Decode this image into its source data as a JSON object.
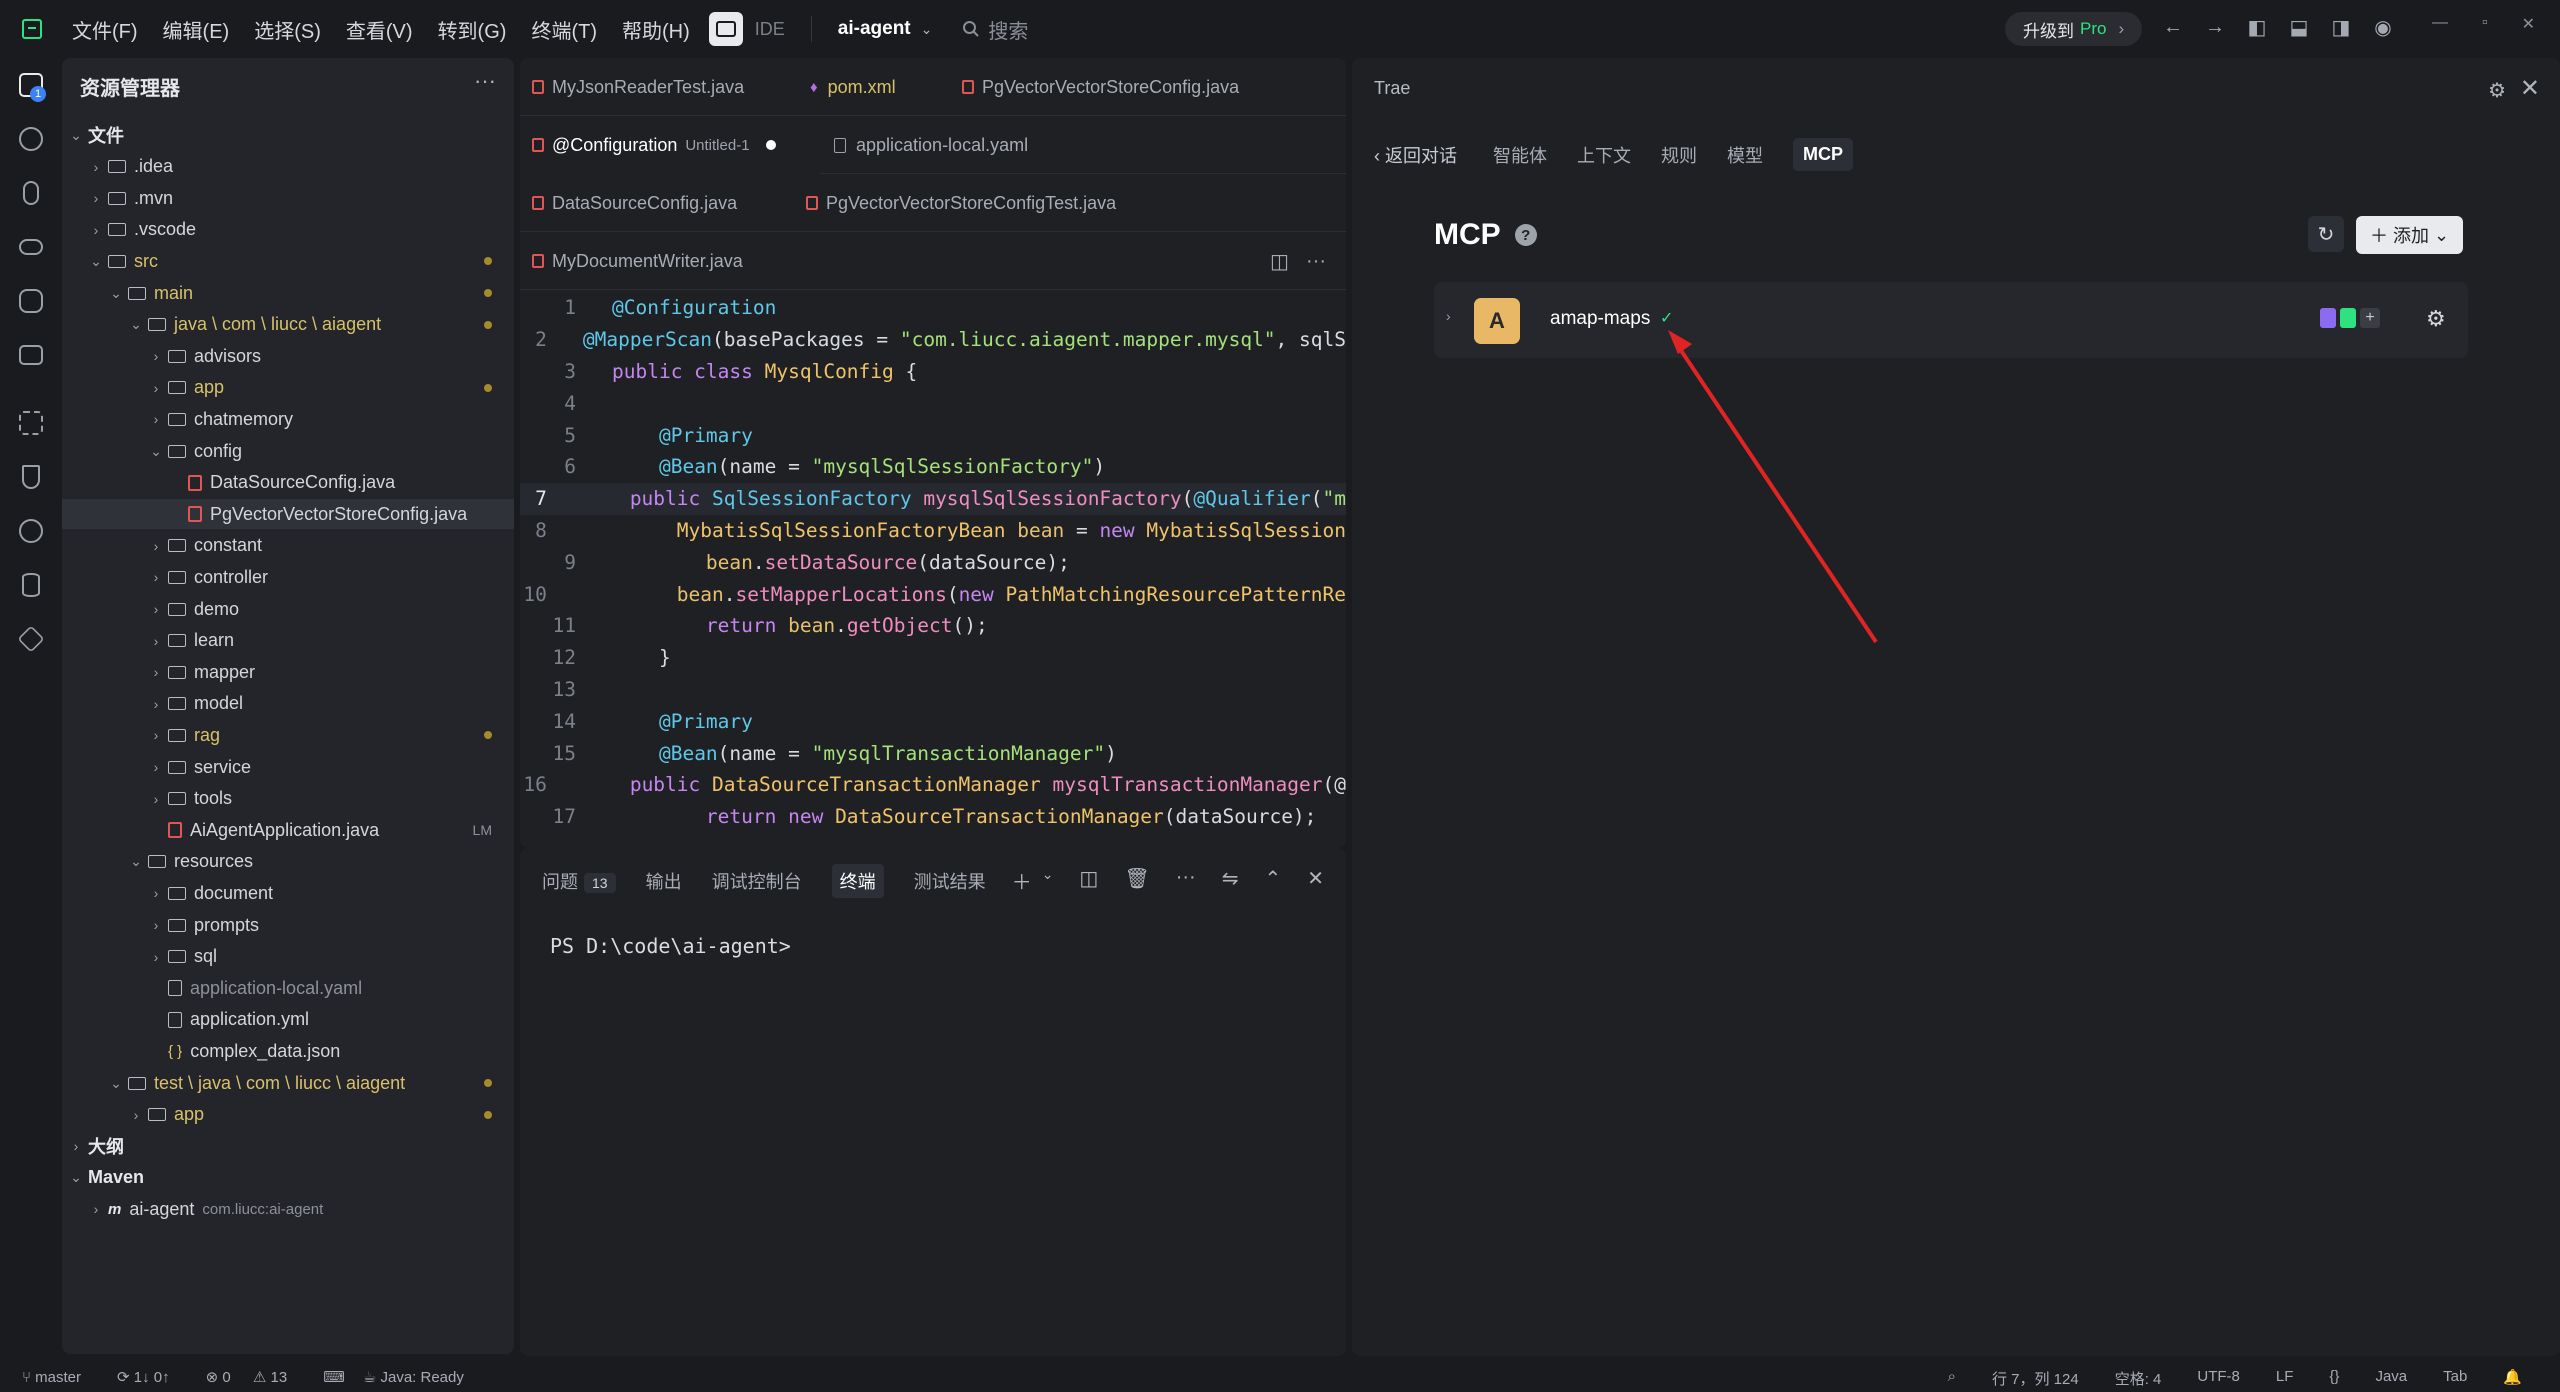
{
  "menu": [
    "文件(F)",
    "编辑(E)",
    "选择(S)",
    "查看(V)",
    "转到(G)",
    "终端(T)",
    "帮助(H)"
  ],
  "mode_label": "IDE",
  "project_name": "ai-agent",
  "search_placeholder": "搜索",
  "upgrade": {
    "label": "升级到",
    "pro": "Pro"
  },
  "activity_badge": "1",
  "explorer": {
    "title": "资源管理器",
    "rows": [
      {
        "label": "文件",
        "type": "section",
        "open": true,
        "depth": 0
      },
      {
        "label": ".idea",
        "type": "folder",
        "depth": 1
      },
      {
        "label": ".mvn",
        "type": "folder",
        "depth": 1
      },
      {
        "label": ".vscode",
        "type": "folder",
        "depth": 1
      },
      {
        "label": "src",
        "type": "folder",
        "open": true,
        "depth": 1,
        "mod": true
      },
      {
        "label": "main",
        "type": "folder",
        "open": true,
        "depth": 2,
        "mod": true
      },
      {
        "label": "java \\ com \\ liucc \\ aiagent",
        "type": "folder",
        "open": true,
        "depth": 3,
        "mod": true
      },
      {
        "label": "advisors",
        "type": "folder",
        "depth": 4
      },
      {
        "label": "app",
        "type": "folder",
        "depth": 4,
        "mod": true
      },
      {
        "label": "chatmemory",
        "type": "folder",
        "depth": 4
      },
      {
        "label": "config",
        "type": "folder",
        "open": true,
        "depth": 4
      },
      {
        "label": "DataSourceConfig.java",
        "type": "java",
        "depth": 5
      },
      {
        "label": "PgVectorVectorStoreConfig.java",
        "type": "java",
        "depth": 5,
        "selected": true
      },
      {
        "label": "constant",
        "type": "folder",
        "depth": 4
      },
      {
        "label": "controller",
        "type": "folder",
        "depth": 4
      },
      {
        "label": "demo",
        "type": "folder",
        "depth": 4
      },
      {
        "label": "learn",
        "type": "folder",
        "depth": 4
      },
      {
        "label": "mapper",
        "type": "folder",
        "depth": 4
      },
      {
        "label": "model",
        "type": "folder",
        "depth": 4
      },
      {
        "label": "rag",
        "type": "folder",
        "depth": 4,
        "mod": true
      },
      {
        "label": "service",
        "type": "folder",
        "depth": 4
      },
      {
        "label": "tools",
        "type": "folder",
        "depth": 4
      },
      {
        "label": "AiAgentApplication.java",
        "type": "java",
        "depth": 4,
        "badge": "LM"
      },
      {
        "label": "resources",
        "type": "folder",
        "open": true,
        "depth": 3
      },
      {
        "label": "document",
        "type": "folder",
        "depth": 4
      },
      {
        "label": "prompts",
        "type": "folder",
        "depth": 4
      },
      {
        "label": "sql",
        "type": "folder",
        "depth": 4
      },
      {
        "label": "application-local.yaml",
        "type": "file",
        "depth": 4,
        "dim": true
      },
      {
        "label": "application.yml",
        "type": "file",
        "depth": 4
      },
      {
        "label": "complex_data.json",
        "type": "json",
        "depth": 4
      },
      {
        "label": "test \\ java \\ com \\ liucc \\ aiagent",
        "type": "folder",
        "open": true,
        "depth": 2,
        "mod": true
      },
      {
        "label": "app",
        "type": "folder",
        "depth": 3,
        "mod": true
      },
      {
        "label": "大纲",
        "type": "section",
        "depth": 0
      },
      {
        "label": "Maven",
        "type": "section",
        "open": true,
        "depth": 0
      },
      {
        "label": "ai-agent",
        "type": "maven",
        "depth": 1,
        "sub": "com.liucc:ai-agent"
      }
    ]
  },
  "editor": {
    "tabs_row1": [
      "MyJsonReaderTest.java",
      "pom.xml",
      "PgVectorVectorStoreConfig.java"
    ],
    "tabs_row2": {
      "active": "@Configuration",
      "active_sub": "Untitled-1",
      "other": "application-local.yaml"
    },
    "tabs_row3": [
      "DataSourceConfig.java",
      "PgVectorVectorStoreConfigTest.java"
    ],
    "tabs_row4": [
      "MyDocumentWriter.java"
    ],
    "current_line": 7,
    "lines": [
      {
        "n": "1",
        "html": "<span class='an'>@Configuration</span>"
      },
      {
        "n": "2",
        "html": "<span class='an'>@MapperScan</span><span class='pl'>(basePackages = </span><span class='s'>\"com.liucc.aiagent.mapper.mysql\"</span><span class='pl'>, sqlS</span>"
      },
      {
        "n": "3",
        "html": "<span class='k'>public class </span><span class='t'>MysqlConfig </span><span class='pl'>{</span>"
      },
      {
        "n": "4",
        "html": ""
      },
      {
        "n": "5",
        "html": "    <span class='an'>@Primary</span>"
      },
      {
        "n": "6",
        "html": "    <span class='an'>@Bean</span><span class='pl'>(name = </span><span class='s'>\"mysqlSqlSessionFactory\"</span><span class='pl'>)</span>"
      },
      {
        "n": "7",
        "html": "    <span class='k'>public </span><span class='an'>SqlSessionFactory </span><span class='f'>mysqlSqlSessionFactory</span><span class='pl'>(</span><span class='an'>@Qualifier</span><span class='pl'>(</span><span class='s'>\"m</span>"
      },
      {
        "n": "8",
        "html": "        <span class='t'>MybatisSqlSessionFactoryBean </span><span class='fn'>bean </span><span class='pl'>= </span><span class='k'>new </span><span class='t'>MybatisSqlSession</span>"
      },
      {
        "n": "9",
        "html": "        <span class='fn'>bean</span><span class='pl'>.</span><span class='f'>setDataSource</span><span class='pl'>(dataSource);</span>"
      },
      {
        "n": "10",
        "html": "        <span class='fn'>bean</span><span class='pl'>.</span><span class='f'>setMapperLocations</span><span class='pl'>(</span><span class='k'>new </span><span class='t'>PathMatchingResourcePatternRe</span>"
      },
      {
        "n": "11",
        "html": "        <span class='k'>return </span><span class='fn'>bean</span><span class='pl'>.</span><span class='f'>getObject</span><span class='pl'>();</span>"
      },
      {
        "n": "12",
        "html": "    <span class='pl'>}</span>"
      },
      {
        "n": "13",
        "html": ""
      },
      {
        "n": "14",
        "html": "    <span class='an'>@Primary</span>"
      },
      {
        "n": "15",
        "html": "    <span class='an'>@Bean</span><span class='pl'>(name = </span><span class='s'>\"mysqlTransactionManager\"</span><span class='pl'>)</span>"
      },
      {
        "n": "16",
        "html": "    <span class='k'>public </span><span class='t'>DataSourceTransactionManager </span><span class='f'>mysqlTransactionManager</span><span class='pl'>(@</span>"
      },
      {
        "n": "17",
        "html": "        <span class='k'>return new </span><span class='t'>DataSourceTransactionManager</span><span class='pl'>(dataSource);</span>"
      }
    ]
  },
  "panel": {
    "tabs": [
      "问题",
      "输出",
      "调试控制台",
      "终端",
      "测试结果"
    ],
    "problems_count": "13",
    "active_tab": "终端",
    "terminal_text": "PS D:\\code\\ai-agent>"
  },
  "trae": {
    "title": "Trae",
    "back": "返回对话",
    "tabs": [
      "智能体",
      "上下文",
      "规则",
      "模型",
      "MCP"
    ],
    "active_tab": "MCP",
    "heading": "MCP",
    "add_label": "添加",
    "server": {
      "avatar": "A",
      "name": "amap-maps",
      "status": "✓"
    }
  },
  "status": {
    "branch": "master",
    "sync": "1↓ 0↑",
    "errors": "0",
    "warnings": "13",
    "java": "Java: Ready",
    "cursor": "行 7，列 124",
    "spaces": "空格: 4",
    "encoding": "UTF-8",
    "eol": "LF",
    "braces": "{}",
    "lang": "Java",
    "tab": "Tab"
  },
  "colors": {
    "accent": "#2ee37e",
    "arrow": "#e02424",
    "avatar": "#e9b866"
  }
}
